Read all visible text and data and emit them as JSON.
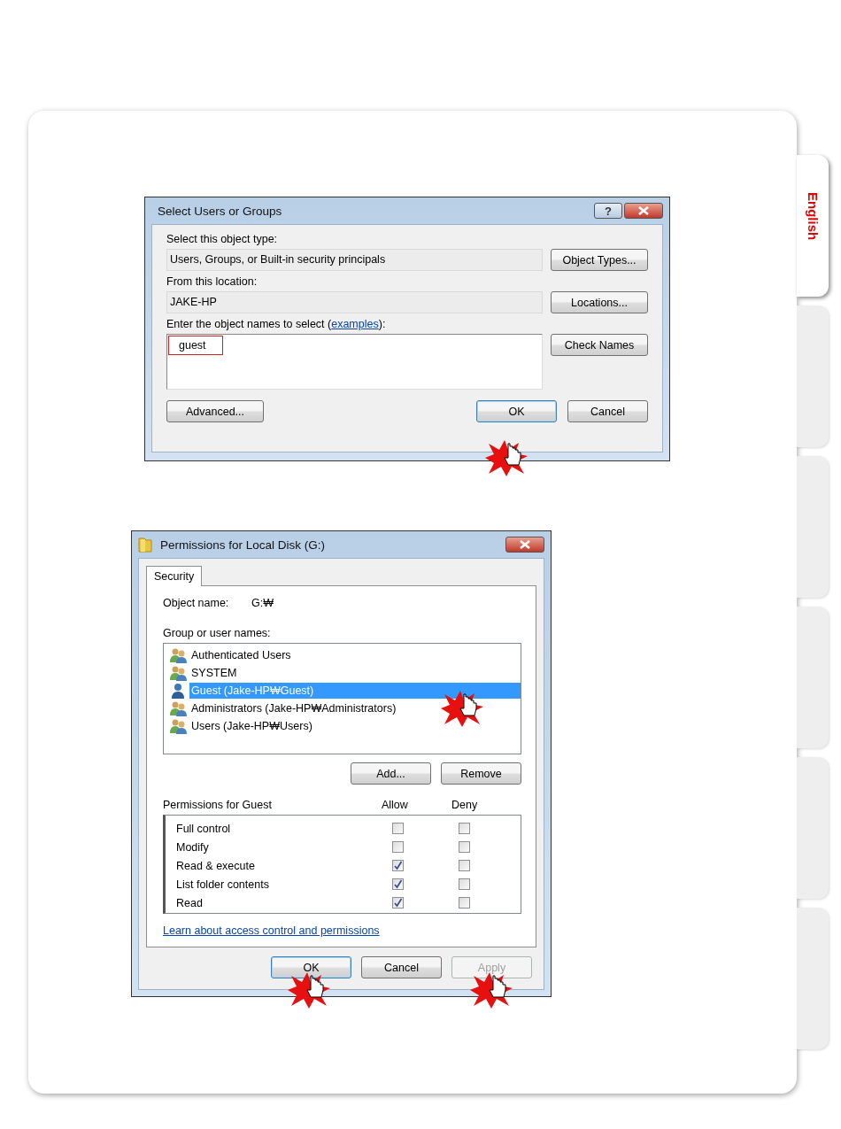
{
  "side_tabs": [
    {
      "label": "English",
      "selected": true
    },
    {
      "selected": false
    },
    {
      "selected": false
    },
    {
      "selected": false
    },
    {
      "selected": false
    },
    {
      "selected": false
    }
  ],
  "select_dialog": {
    "title": "Select Users or Groups",
    "help_button": "?",
    "object_type_label": "Select this object type:",
    "object_type_value": "Users, Groups, or Built-in security principals",
    "object_types_button": "Object Types...",
    "location_label": "From this location:",
    "location_value": "JAKE-HP",
    "locations_button": "Locations...",
    "names_label_before": "Enter the object names to select (",
    "names_link": "examples",
    "names_label_after": "):",
    "names_value": "guest",
    "names_highlighted": true,
    "check_names_button": "Check Names",
    "advanced_button": "Advanced...",
    "buttons": [
      {
        "label": "OK",
        "default": true
      },
      {
        "label": "Cancel",
        "default": false
      }
    ]
  },
  "permissions_dialog": {
    "title": "Permissions for Local Disk (G:)",
    "tabs": [
      {
        "label": "Security",
        "selected": true
      }
    ],
    "object_name_label": "Object name:",
    "object_name_value": "G:₩",
    "group_label": "Group or user names:",
    "users": [
      {
        "name": "Authenticated Users",
        "kind": "group",
        "selected": false
      },
      {
        "name": "SYSTEM",
        "kind": "group",
        "selected": false
      },
      {
        "name": "Guest (Jake-HP₩Guest)",
        "kind": "user",
        "selected": true
      },
      {
        "name": "Administrators (Jake-HP₩Administrators)",
        "kind": "group",
        "selected": false
      },
      {
        "name": "Users (Jake-HP₩Users)",
        "kind": "group",
        "selected": false
      }
    ],
    "add_button": "Add...",
    "remove_button": "Remove",
    "permissions_label": "Permissions for Guest",
    "allow_header": "Allow",
    "deny_header": "Deny",
    "permissions": [
      {
        "name": "Full control",
        "allow": false,
        "deny": false
      },
      {
        "name": "Modify",
        "allow": false,
        "deny": false
      },
      {
        "name": "Read & execute",
        "allow": true,
        "deny": false
      },
      {
        "name": "List folder contents",
        "allow": true,
        "deny": false
      },
      {
        "name": "Read",
        "allow": true,
        "deny": false
      }
    ],
    "learn_link": "Learn about access control and permissions",
    "buttons": [
      {
        "label": "OK",
        "default": true,
        "disabled": false
      },
      {
        "label": "Cancel",
        "default": false,
        "disabled": false
      },
      {
        "label": "Apply",
        "default": false,
        "disabled": true
      }
    ]
  }
}
